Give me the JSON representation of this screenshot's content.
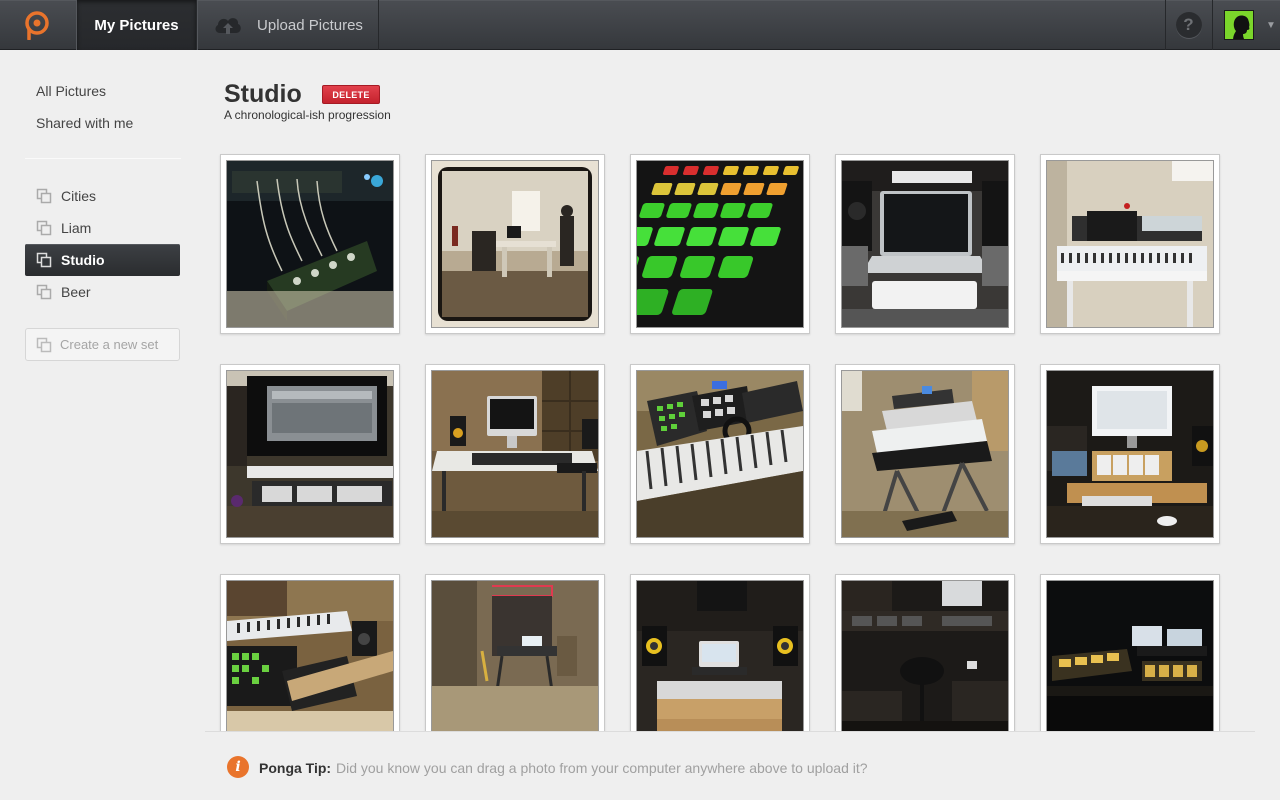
{
  "topbar": {
    "logo_icon": "ponga-logo-icon",
    "tabs": [
      {
        "label": "My Pictures",
        "active": true
      },
      {
        "label": "Upload Pictures",
        "icon": "cloud-upload-icon",
        "active": false
      }
    ],
    "help_label": "?",
    "accent_color": "#e9742c"
  },
  "sidebar": {
    "links": [
      {
        "label": "All Pictures"
      },
      {
        "label": "Shared with me"
      }
    ],
    "sets": [
      {
        "label": "Cities",
        "icon": "set-icon",
        "active": false
      },
      {
        "label": "Liam",
        "icon": "set-icon",
        "active": false
      },
      {
        "label": "Studio",
        "icon": "set-icon",
        "active": true
      },
      {
        "label": "Beer",
        "icon": "set-icon",
        "active": false
      }
    ],
    "new_set_label": "Create a new set"
  },
  "main": {
    "title": "Studio",
    "delete_label": "DELETE",
    "subtitle": "A chronological-ish progression"
  },
  "photos": [
    {
      "scene": "modular-synth"
    },
    {
      "scene": "studio-room"
    },
    {
      "scene": "launchpad-grid"
    },
    {
      "scene": "laptop-desk"
    },
    {
      "scene": "keyboard-desk"
    },
    {
      "scene": "monitor-desk"
    },
    {
      "scene": "imac-desk"
    },
    {
      "scene": "controllers-stand"
    },
    {
      "scene": "keyboard-stand"
    },
    {
      "scene": "lit-monitor-desk"
    },
    {
      "scene": "shelf-keyboards"
    },
    {
      "scene": "red-light-corner"
    },
    {
      "scene": "speaker-wall"
    },
    {
      "scene": "dark-room-setup"
    },
    {
      "scene": "dark-screens"
    }
  ],
  "tip": {
    "label": "Ponga Tip:",
    "text": "Did you know you can drag a photo from your computer anywhere above to upload it?",
    "icon": "info-icon"
  }
}
